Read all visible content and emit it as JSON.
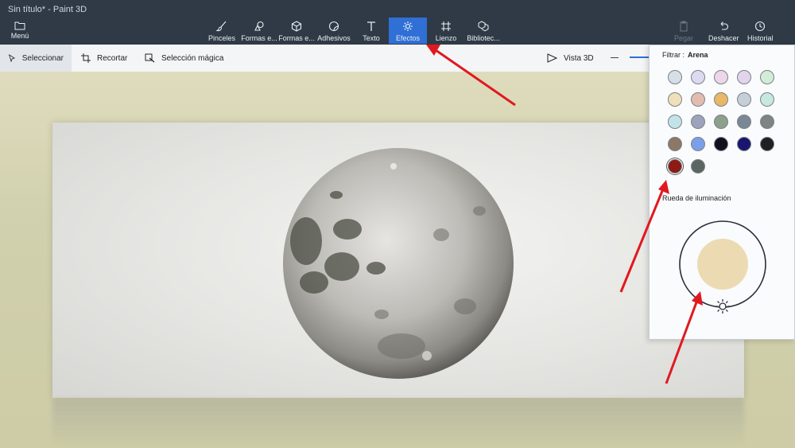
{
  "window": {
    "title": "Sin título* - Paint 3D"
  },
  "menu": {
    "label": "Menú",
    "icon": "folder-icon"
  },
  "toolbar": {
    "tools": [
      {
        "label": "Pinceles",
        "icon": "brush-icon"
      },
      {
        "label": "Formas e...",
        "icon": "shapes-2d-icon"
      },
      {
        "label": "Formas e...",
        "icon": "shapes-3d-icon"
      },
      {
        "label": "Adhesivos",
        "icon": "sticker-icon"
      },
      {
        "label": "Texto",
        "icon": "text-icon"
      },
      {
        "label": "Efectos",
        "icon": "effects-icon",
        "active": true
      },
      {
        "label": "Lienzo",
        "icon": "canvas-icon"
      },
      {
        "label": "Bibliotec...",
        "icon": "library-icon"
      }
    ],
    "right": [
      {
        "label": "Pegar",
        "icon": "paste-icon",
        "disabled": true
      },
      {
        "label": "Deshacer",
        "icon": "undo-icon"
      },
      {
        "label": "Historial",
        "icon": "history-icon"
      }
    ]
  },
  "subbar": {
    "select": "Seleccionar",
    "crop": "Recortar",
    "magic": "Selección mágica",
    "view3d": "Vista 3D"
  },
  "effects_panel": {
    "filter_label": "Filtrar :",
    "filter_value": "Arena",
    "swatches": [
      "#d6dee6",
      "#dcdaf0",
      "#ecd6ea",
      "#e2d4ec",
      "#d2ecd6",
      "#efe0b9",
      "#e3bcaf",
      "#e8b866",
      "#c6ced8",
      "#c6e8de",
      "#c2e4e8",
      "#9ea2bc",
      "#8e9f8c",
      "#7a8896",
      "#7d8482",
      "#8b7867",
      "#7aa0e8",
      "#12101e",
      "#1a1670",
      "#1d2122",
      "#8e1a14",
      "#5c6661"
    ],
    "selected_swatch": 20,
    "light_label": "Rueda de iluminación",
    "light_color": "#ecdbb2"
  },
  "colors": {
    "titlebar": "#2f3a46",
    "accent": "#2f6fd6",
    "annotation_arrow": "#e0191f"
  }
}
